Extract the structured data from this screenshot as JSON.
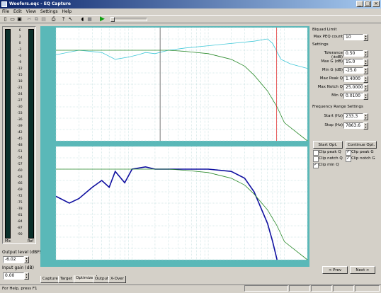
{
  "window": {
    "title": "Woofers.eqc - EQ Capture",
    "minimize": "_",
    "maximize": "□",
    "close": "×"
  },
  "menu": [
    "File",
    "Edit",
    "View",
    "Settings",
    "Help"
  ],
  "toolbar": {
    "icons": [
      "new-icon",
      "open-icon",
      "save-icon",
      "cut-icon",
      "copy-icon",
      "paste-icon",
      "print-icon",
      "help-icon",
      "context-help-icon",
      "speaker-icon",
      "play-icon",
      "stop-icon"
    ]
  },
  "meter": {
    "scale": [
      "6",
      "3",
      "0",
      "-3",
      "-6",
      "-9",
      "-12",
      "-15",
      "-18",
      "-21",
      "-24",
      "-27",
      "-30",
      "-33",
      "-36",
      "-39",
      "-42",
      "-45",
      "-48",
      "-51",
      "-54",
      "-57",
      "-60",
      "-63",
      "-66",
      "-69",
      "-72",
      "-75",
      "-78",
      "-81",
      "-84",
      "-87",
      "-90"
    ],
    "left_label": "Mic",
    "right_label": "Ref"
  },
  "output_level": {
    "label": "Output level (dBFS)",
    "value": "-6.02"
  },
  "input_gain": {
    "label": "Input gain (dB)",
    "value": "0.00"
  },
  "biquad": {
    "section": "Biquad Limit",
    "max_peq_label": "Max PEQ count",
    "max_peq": "10"
  },
  "settings": {
    "section": "Settings",
    "rows": [
      {
        "label": "Tolerance (±dB)",
        "value": "0.50"
      },
      {
        "label": "Max G (dB)",
        "value": "15.0"
      },
      {
        "label": "Min G (dB)",
        "value": "-25.0"
      },
      {
        "label": "Max Peak Q",
        "value": "1.4000"
      },
      {
        "label": "Max Notch Q",
        "value": "25.0000"
      },
      {
        "label": "Min Q",
        "value": "0.0100"
      }
    ]
  },
  "freq_range": {
    "section": "Frequency Range Settings",
    "start_label": "Start (Hz)",
    "start": "233.3",
    "stop_label": "Stop (Hz)",
    "stop": "7863.6"
  },
  "buttons": {
    "start": "Start Opt.",
    "continue": "Continue Opt.",
    "prev": "< Prev",
    "next": "Next >"
  },
  "checks": [
    {
      "label": "Clip peak Q",
      "on": false
    },
    {
      "label": "Clip peak G",
      "on": true
    },
    {
      "label": "Clip notch Q",
      "on": false
    },
    {
      "label": "Clip notch G",
      "on": true
    },
    {
      "label": "Clip min Q",
      "on": true
    }
  ],
  "tabs": [
    "Capture",
    "Target",
    "Optimizer",
    "Output",
    "X-Over"
  ],
  "status": "For Help, press F1",
  "colors": {
    "measured_top": "#40c8d8",
    "target": "#2a8a2a",
    "corrected": "#1010a0",
    "marker": "#e02020",
    "panel": "#5ab8b8"
  },
  "chart_data": [
    {
      "type": "line",
      "xscale": "log",
      "xlim": [
        10,
        20000
      ],
      "ylim": [
        -40,
        10
      ],
      "grid": true,
      "markers_hz": [
        233.3,
        7863.6
      ],
      "series": [
        {
          "x": [
            10,
            20,
            40,
            60,
            90,
            120,
            150,
            200,
            300,
            500,
            1000,
            2000,
            4000,
            6000,
            7000,
            9000,
            12000,
            20000
          ],
          "y": [
            -2,
            0,
            -1,
            -4,
            -3,
            -2,
            -1,
            -1.5,
            0,
            1,
            2,
            3,
            4,
            5,
            3,
            -4,
            -6,
            -8
          ]
        },
        {
          "x": [
            10,
            20,
            40,
            100,
            300,
            500,
            1000,
            2000,
            3000,
            4000,
            6000,
            8000,
            10000,
            20000
          ],
          "y": [
            0,
            0,
            0,
            0,
            0,
            -0.5,
            -1.5,
            -4,
            -7,
            -11,
            -18,
            -25,
            -32,
            -40
          ]
        }
      ]
    },
    {
      "type": "line",
      "xscale": "log",
      "xlim": [
        10,
        20000
      ],
      "ylim": [
        -40,
        10
      ],
      "grid": true,
      "series": [
        {
          "x": [
            10,
            15,
            20,
            30,
            40,
            50,
            60,
            80,
            100,
            150,
            200,
            300,
            500,
            1000,
            2000,
            3000,
            4000,
            6000,
            7000,
            8000
          ],
          "y": [
            -12,
            -15,
            -13,
            -8,
            -5,
            -8,
            -1,
            -6,
            0,
            1,
            0,
            0,
            0,
            0,
            -1,
            -4,
            -10,
            -24,
            -32,
            -40
          ]
        },
        {
          "x": [
            10,
            20,
            40,
            100,
            300,
            500,
            1000,
            2000,
            3000,
            4000,
            6000,
            8000,
            10000,
            20000
          ],
          "y": [
            0,
            0,
            0,
            0,
            0,
            -0.5,
            -1.5,
            -4,
            -7,
            -11,
            -18,
            -25,
            -32,
            -40
          ]
        }
      ]
    }
  ]
}
